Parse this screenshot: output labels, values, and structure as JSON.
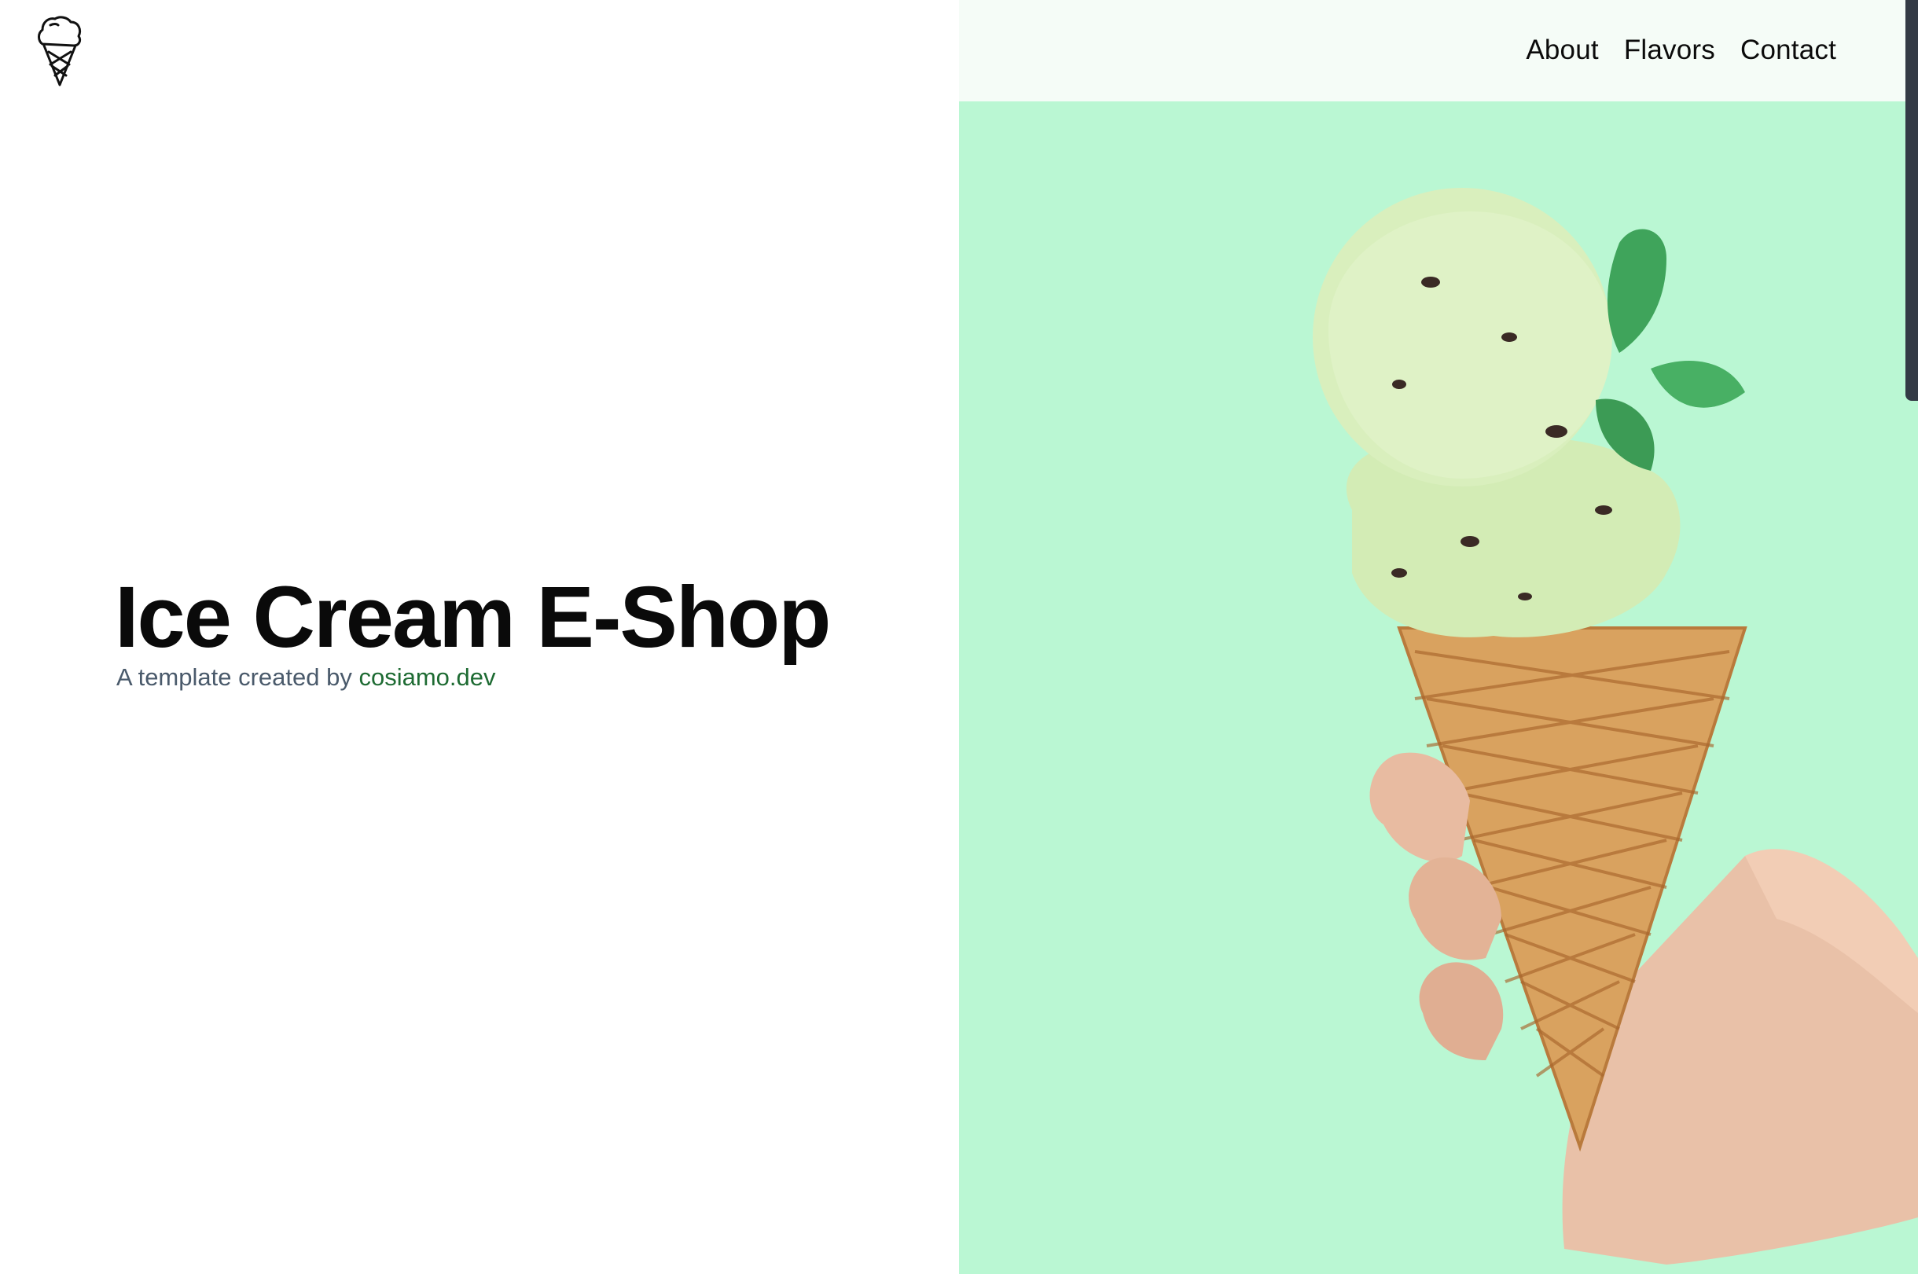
{
  "header": {
    "logo_icon": "ice-cream-cone-icon",
    "nav": [
      {
        "label": "About"
      },
      {
        "label": "Flavors"
      },
      {
        "label": "Contact"
      }
    ]
  },
  "hero": {
    "title": "Ice Cream E-Shop",
    "subtitle_prefix": "A template created by ",
    "subtitle_link": "cosiamo.dev",
    "image_icon": "ice-cream-cone-in-hand-image"
  },
  "colors": {
    "hero_background": "#baf7d3",
    "header_background": "#f5fcf7",
    "link_color": "#1e6b33",
    "subtitle_color": "#4a5a6b"
  }
}
